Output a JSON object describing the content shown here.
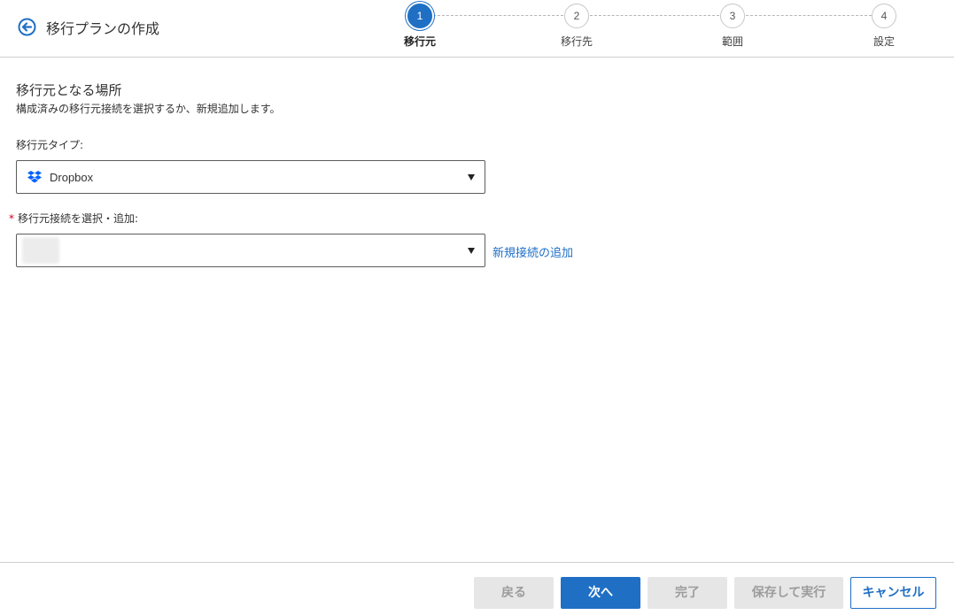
{
  "header": {
    "title": "移行プランの作成",
    "back_icon": "circle-arrow-left-icon"
  },
  "stepper": {
    "steps": [
      {
        "number": "1",
        "label": "移行元",
        "active": true
      },
      {
        "number": "2",
        "label": "移行先",
        "active": false
      },
      {
        "number": "3",
        "label": "範囲",
        "active": false
      },
      {
        "number": "4",
        "label": "設定",
        "active": false
      }
    ]
  },
  "main": {
    "section_title": "移行元となる場所",
    "section_desc": "構成済みの移行元接続を選択するか、新規追加します。",
    "source_type": {
      "label": "移行元タイプ:",
      "value": "Dropbox",
      "icon": "dropbox-icon"
    },
    "connection": {
      "required_mark": "*",
      "label": "移行元接続を選択・追加:",
      "value": ""
    },
    "add_connection_link": "新規接続の追加"
  },
  "footer": {
    "back_label": "戻る",
    "next_label": "次へ",
    "finish_label": "完了",
    "save_run_label": "保存して実行",
    "cancel_label": "キャンセル"
  },
  "colors": {
    "accent": "#1f6fc5",
    "required": "#d0021b",
    "disabled_bg": "#e6e6e6"
  }
}
